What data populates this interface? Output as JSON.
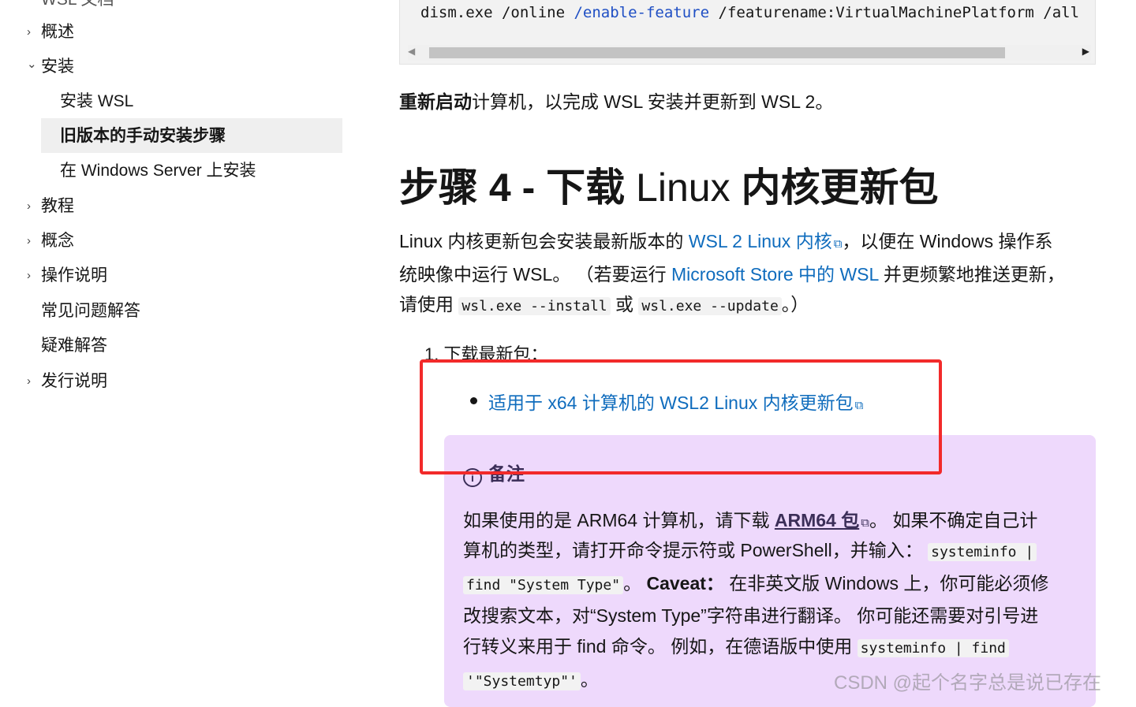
{
  "sidebar": {
    "top_partial": "WSL 文档",
    "items": [
      {
        "label": "概述",
        "chevron": "›"
      },
      {
        "label": "安装",
        "chevron": "⌄"
      },
      {
        "label": "安装 WSL"
      },
      {
        "label": "旧版本的手动安装步骤"
      },
      {
        "label": "在 Windows Server 上安装"
      },
      {
        "label": "教程",
        "chevron": "›"
      },
      {
        "label": "概念",
        "chevron": "›"
      },
      {
        "label": "操作说明",
        "chevron": "›"
      },
      {
        "label": "常见问题解答"
      },
      {
        "label": "疑难解答"
      },
      {
        "label": "发行说明",
        "chevron": "›"
      }
    ]
  },
  "code": {
    "part1": "dism.exe /online ",
    "keyword": "/enable-feature",
    "part2": " /featurename:VirtualMachinePlatform /all"
  },
  "restart": {
    "bold": "重新启动",
    "rest": "计算机，以完成 WSL 安装并更新到 WSL 2。"
  },
  "heading": {
    "part1": "步骤 4 - 下载 ",
    "linux": "Linux",
    "part2": " 内核更新包"
  },
  "intro": {
    "t1": "Linux 内核更新包会安装最新版本的 ",
    "link1": "WSL 2 Linux 内核",
    "t2": "，以便在 Windows 操作系",
    "t3": "统映像中运行 WSL。 （若要运行 ",
    "link2": "Microsoft Store 中的 WSL",
    "t4": " 并更频繁地推送更新，",
    "t5": "请使用 ",
    "code1": "wsl.exe --install",
    "t6": " 或 ",
    "code2": "wsl.exe --update",
    "t7": "。）"
  },
  "steps": {
    "item1": "1. 下载最新包：",
    "download_link": "适用于 x64 计算机的 WSL2 Linux 内核更新包"
  },
  "note": {
    "title": "备注",
    "l1a": "如果使用的是 ARM64 计算机，请下载 ",
    "l1link": "ARM64 包",
    "l1b": "。 如果不确定自己计",
    "l2a": "算机的类型，请打开命令提示符或 PowerShell，并输入： ",
    "l2code": "systeminfo |",
    "l3code": "find \"System Type\"",
    "l3a": "。 ",
    "l3bold": "Caveat：",
    "l3b": " 在非英文版 Windows 上，你可能必须修",
    "l4": "改搜索文本，对“System Type”字符串进行翻译。 你可能还需要对引号进",
    "l5a": "行转义来用于 find 命令。 例如，在德语版中使用 ",
    "l5code": "systeminfo | find",
    "l6code": "'\"Systemtyp\"'",
    "l6a": "。"
  },
  "watermark": "CSDN @起个名字总是说已存在",
  "colors": {
    "link": "#0f6cbd",
    "note_bg": "#eed9fc",
    "highlight_box": "#f22a2a",
    "selected_nav_bg": "#efefef"
  }
}
